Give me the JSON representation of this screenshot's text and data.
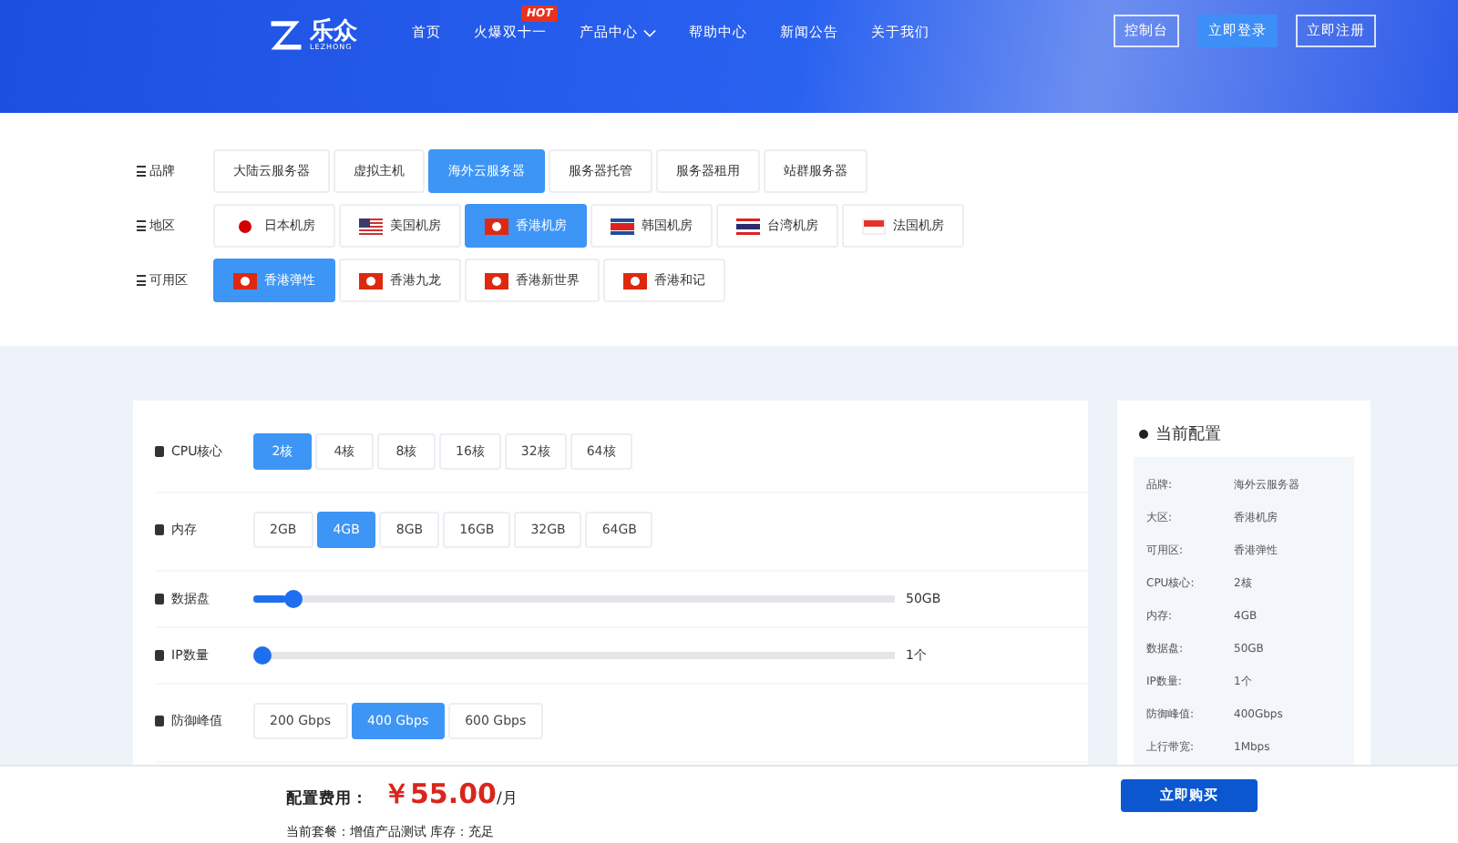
{
  "header": {
    "logo_text": "乐众",
    "logo_sub": "LEZHONG",
    "nav": [
      {
        "label": "首页",
        "dropdown": false
      },
      {
        "label": "火爆双十一",
        "badge": "HOT",
        "dropdown": false
      },
      {
        "label": "产品中心",
        "dropdown": true
      },
      {
        "label": "帮助中心",
        "dropdown": false
      },
      {
        "label": "新闻公告",
        "dropdown": false
      },
      {
        "label": "关于我们",
        "dropdown": false
      }
    ],
    "actions": [
      {
        "label": "控制台",
        "kind": "outline"
      },
      {
        "label": "立即登录",
        "kind": "filled"
      },
      {
        "label": "立即注册",
        "kind": "outline"
      }
    ]
  },
  "filters": [
    {
      "label": "品牌",
      "options": [
        {
          "label": "大陆云服务器",
          "selected": false
        },
        {
          "label": "虚拟主机",
          "selected": false
        },
        {
          "label": "海外云服务器",
          "selected": true
        },
        {
          "label": "服务器托管",
          "selected": false
        },
        {
          "label": "服务器租用",
          "selected": false
        },
        {
          "label": "站群服务器",
          "selected": false
        }
      ]
    },
    {
      "label": "地区",
      "options": [
        {
          "label": "日本机房",
          "kind": "jp",
          "selected": false
        },
        {
          "label": "美国机房",
          "kind": "us",
          "selected": false
        },
        {
          "label": "香港机房",
          "kind": "hk",
          "selected": true
        },
        {
          "label": "韩国机房",
          "kind": "kp",
          "selected": false
        },
        {
          "label": "台湾机房",
          "kind": "th",
          "selected": false
        },
        {
          "label": "法国机房",
          "kind": "sg",
          "selected": false
        }
      ]
    },
    {
      "label": "可用区",
      "options": [
        {
          "label": "香港弹性",
          "kind": "hk",
          "selected": true
        },
        {
          "label": "香港九龙",
          "kind": "hk",
          "selected": false
        },
        {
          "label": "香港新世界",
          "kind": "hk",
          "selected": false
        },
        {
          "label": "香港和记",
          "kind": "hk",
          "selected": false
        }
      ]
    }
  ],
  "config": [
    {
      "kind": "options",
      "label": "CPU核心",
      "options": [
        {
          "label": "2核",
          "selected": true
        },
        {
          "label": "4核",
          "selected": false
        },
        {
          "label": "8核",
          "selected": false
        },
        {
          "label": "16核",
          "selected": false
        },
        {
          "label": "32核",
          "selected": false
        },
        {
          "label": "64核",
          "selected": false
        }
      ]
    },
    {
      "kind": "options",
      "label": "内存",
      "options": [
        {
          "label": "2GB",
          "selected": false
        },
        {
          "label": "4GB",
          "selected": true
        },
        {
          "label": "8GB",
          "selected": false
        },
        {
          "label": "16GB",
          "selected": false
        },
        {
          "label": "32GB",
          "selected": false
        },
        {
          "label": "64GB",
          "selected": false
        }
      ]
    },
    {
      "kind": "slider",
      "label": "数据盘",
      "level": 0.05,
      "reading": "50GB"
    },
    {
      "kind": "slider",
      "label": "IP数量",
      "level": 0,
      "reading": "1个"
    },
    {
      "kind": "options",
      "label": "防御峰值",
      "options": [
        {
          "label": "200 Gbps",
          "selected": false
        },
        {
          "label": "400 Gbps",
          "selected": true
        },
        {
          "label": "600 Gbps",
          "selected": false
        }
      ]
    }
  ],
  "summary": {
    "title": "当前配置",
    "rows": [
      {
        "key": "品牌:",
        "value": "海外云服务器"
      },
      {
        "key": "大区:",
        "value": "香港机房"
      },
      {
        "key": "可用区:",
        "value": "香港弹性"
      },
      {
        "key": "CPU核心:",
        "value": "2核"
      },
      {
        "key": "内存:",
        "value": "4GB"
      },
      {
        "key": "数据盘:",
        "value": "50GB"
      },
      {
        "key": "IP数量:",
        "value": "1个"
      },
      {
        "key": "防御峰值:",
        "value": "400Gbps"
      },
      {
        "key": "上行带宽:",
        "value": "1Mbps"
      }
    ]
  },
  "footer": {
    "price_label": "配置费用：",
    "price": "￥55.00",
    "unit": "/月",
    "buy": "立即购买",
    "package": "当前套餐：增值产品测试 库存：充足"
  }
}
